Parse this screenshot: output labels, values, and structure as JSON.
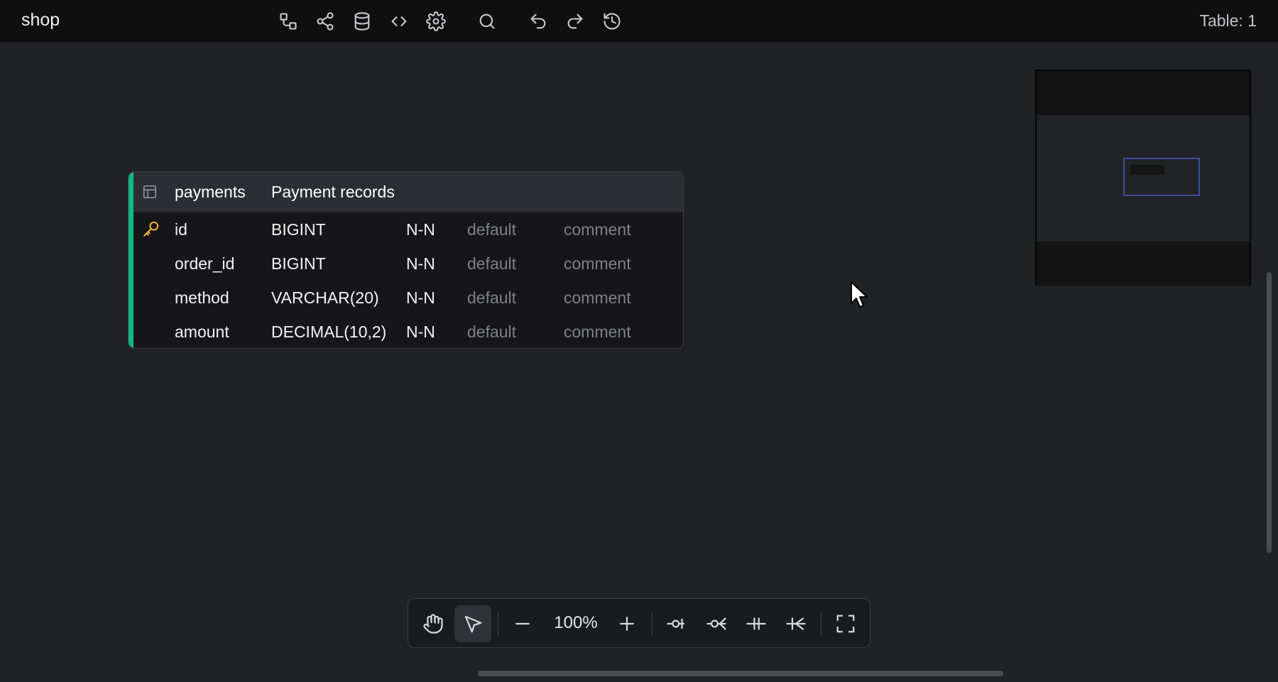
{
  "header": {
    "title": "shop",
    "table_count": "Table: 1",
    "icons": [
      "diagram-icon",
      "share-icon",
      "database-icon",
      "code-icon",
      "settings-icon",
      "search-icon",
      "undo-icon",
      "redo-icon",
      "history-icon"
    ]
  },
  "table": {
    "name": "payments",
    "comment": "Payment records",
    "accent_color": "#10b981",
    "fields": [
      {
        "name": "id",
        "type": "BIGINT",
        "nullable": "N-N",
        "default": "default",
        "comment": "comment",
        "primary_key": true
      },
      {
        "name": "order_id",
        "type": "BIGINT",
        "nullable": "N-N",
        "default": "default",
        "comment": "comment",
        "primary_key": false
      },
      {
        "name": "method",
        "type": "VARCHAR(20)",
        "nullable": "N-N",
        "default": "default",
        "comment": "comment",
        "primary_key": false
      },
      {
        "name": "amount",
        "type": "DECIMAL(10,2)",
        "nullable": "N-N",
        "default": "default",
        "comment": "comment",
        "primary_key": false
      }
    ]
  },
  "toolbar": {
    "zoom": "100%",
    "tools": [
      "hand-tool",
      "select-tool",
      "zoom-out",
      "zoom-in",
      "one-to-one",
      "one-to-many",
      "mandatory-one",
      "many",
      "fullscreen"
    ],
    "active_tool": "select-tool"
  },
  "colors": {
    "background": "#212226",
    "topbar": "#0f0f10",
    "key_icon": "#f5b82e",
    "minimap_viewport": "#3a4f9a"
  }
}
